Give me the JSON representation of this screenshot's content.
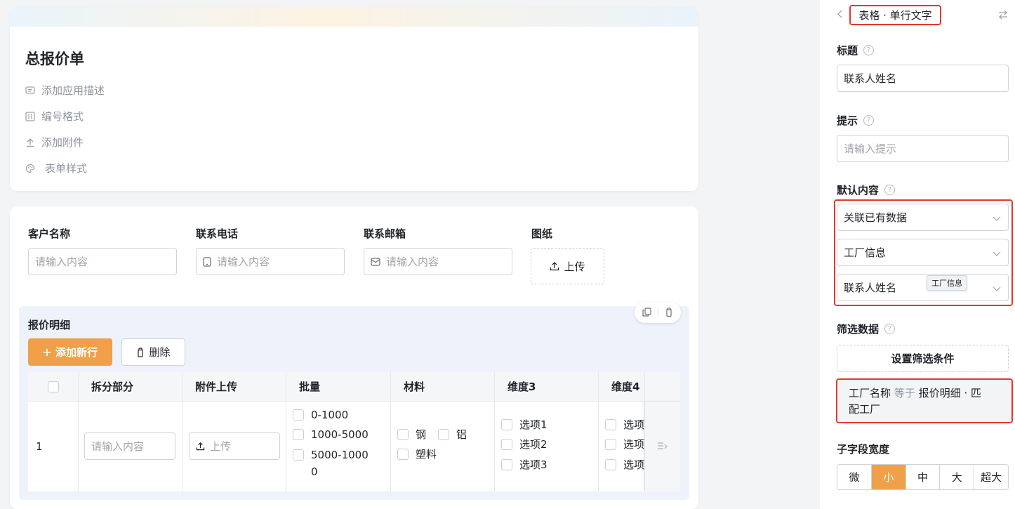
{
  "form": {
    "title": "总报价单",
    "meta": {
      "add_description": "添加应用描述",
      "number_format": "编号格式",
      "add_attachment": "添加附件",
      "form_style": "表单样式"
    }
  },
  "fields": {
    "customer_name": {
      "label": "客户名称",
      "placeholder": "请输入内容"
    },
    "phone": {
      "label": "联系电话",
      "placeholder": "请输入内容"
    },
    "email": {
      "label": "联系邮箱",
      "placeholder": "请输入内容"
    },
    "drawing": {
      "label": "图纸",
      "upload_label": "上传"
    }
  },
  "subform": {
    "title": "报价明细",
    "add_row_label": "添加新行",
    "delete_label": "删除",
    "columns": [
      "拆分部分",
      "附件上传",
      "批量",
      "材料",
      "维度3",
      "维度4"
    ],
    "row": {
      "index": "1",
      "split_placeholder": "请输入内容",
      "upload_label": "上传",
      "batch_options": [
        "0-1000",
        "1000-5000",
        "5000-1000",
        "0"
      ],
      "material_options": [
        "钢",
        "铝",
        "塑料"
      ],
      "dim3_options": [
        "选项1",
        "选项2",
        "选项3"
      ],
      "dim4_options": [
        "选项",
        "选项",
        "选项"
      ]
    }
  },
  "panel": {
    "header_title": "表格 · 单行文字",
    "title_label": "标题",
    "title_value": "联系人姓名",
    "hint_label": "提示",
    "hint_placeholder": "请输入提示",
    "default_label": "默认内容",
    "default_mode": "关联已有数据",
    "default_source": "工厂信息",
    "default_field": "联系人姓名",
    "tooltip": "工厂信息",
    "filter_label": "筛选数据",
    "filter_button": "设置筛选条件",
    "condition": {
      "field": "工厂名称",
      "operator": "等于",
      "value_line1": "报价明细 · 匹",
      "value_line2": "配工厂"
    },
    "width_label": "子字段宽度",
    "width_options": [
      "微",
      "小",
      "中",
      "大",
      "超大"
    ],
    "width_selected": "小"
  },
  "colors": {
    "accent": "#f0a048",
    "highlight_border": "#e03a2e",
    "subform_bg": "#eef2fb"
  }
}
